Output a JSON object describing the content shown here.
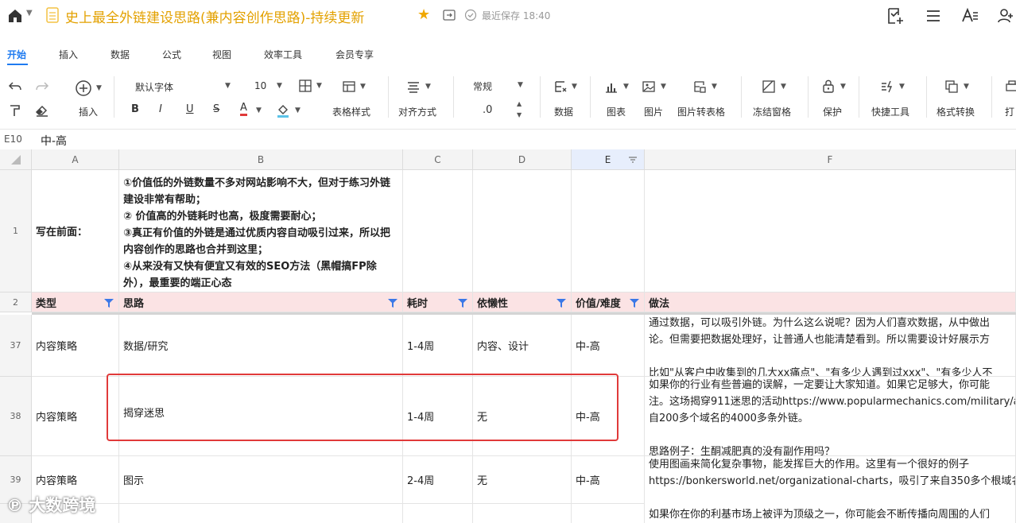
{
  "titlebar": {
    "doc_title": "史上最全外链建设思路(兼内容创作思路)-持续更新",
    "saved_text": "最近保存 18:40"
  },
  "tabs": [
    {
      "label": "开始",
      "active": true
    },
    {
      "label": "插入"
    },
    {
      "label": "数据"
    },
    {
      "label": "公式"
    },
    {
      "label": "视图"
    },
    {
      "label": "效率工具"
    },
    {
      "label": "会员专享"
    }
  ],
  "toolbar": {
    "insert": "插入",
    "font_name": "默认字体",
    "font_size": "10",
    "bold": "B",
    "italic": "I",
    "underline": "U",
    "strike": "S",
    "font_color": "A",
    "table_style": "表格样式",
    "align": "对齐方式",
    "number_format": "常规",
    "decimal": ".0",
    "data": "数据",
    "chart": "图表",
    "image": "图片",
    "image_to_table": "图片转表格",
    "freeze": "冻结窗格",
    "protect": "保护",
    "quick_tools": "快捷工具",
    "format_convert": "格式转换",
    "print": "打"
  },
  "formula_bar": {
    "cell_ref": "E10",
    "value": "中-高"
  },
  "columns": [
    "A",
    "B",
    "C",
    "D",
    "E",
    "F"
  ],
  "rows": [
    {
      "num": "1",
      "a": "写在前面：",
      "b": "①价值低的外链数量不多对网站影响不大，但对于练习外链建设非常有帮助；\n② 价值高的外链耗时也高，极度需要耐心；\n③真正有价值的外链是通过优质内容自动吸引过来，所以把内容创作的思路也合并到这里；\n④从来没有又快有便宜又有效的SEO方法（黑帽搞FP除外），最重要的端正心态"
    },
    {
      "num": "2",
      "a": "类型",
      "b": "思路",
      "c": "耗时",
      "d": "依懒性",
      "e": "价值/难度",
      "f": "做法"
    },
    {
      "num": "37",
      "a": "内容策略",
      "b": "数据/研究",
      "c": "1-4周",
      "d": "内容、设计",
      "e": "中-高",
      "f": "通过数据，可以吸引外链。为什么这么说呢？因为人们喜欢数据，从中做出\n论。但需要把数据处理好，让普通人也能清楚看到。所以需要设计好展示方\n\n比如\"从客户中收集到的几大xx痛点\"、\"有多少人遇到过xxx\"、\"有多少人不"
    },
    {
      "num": "38",
      "a": "内容策略",
      "b": "揭穿迷思",
      "c": "1-4周",
      "d": "无",
      "e": "中-高",
      "f": "如果你的行业有些普遍的误解，一定要让大家知道。如果它足够大，你可能\n注。这场揭穿911迷思的活动https://www.popularmechanics.com/military/a\n自200多个域名的4000多条外链。\n\n思路例子：生酮减肥真的没有副作用吗？"
    },
    {
      "num": "39",
      "a": "内容策略",
      "b": "图示",
      "c": "2-4周",
      "d": "无",
      "e": "中-高",
      "f": "使用图画来简化复杂事物，能发挥巨大的作用。这里有一个很好的例子\nhttps://bonkersworld.net/organizational-charts，吸引了来自350多个根域名\n\n如果你在你的利基市场上被评为顶级之一，你可能会不断传播向周围的人们"
    }
  ],
  "watermark_text": "大数跨境",
  "colors": {
    "accent": "#1f7bf0",
    "title": "#e3a100",
    "header_fill": "#fbe3e4",
    "highlight_box": "#e03a3a"
  }
}
